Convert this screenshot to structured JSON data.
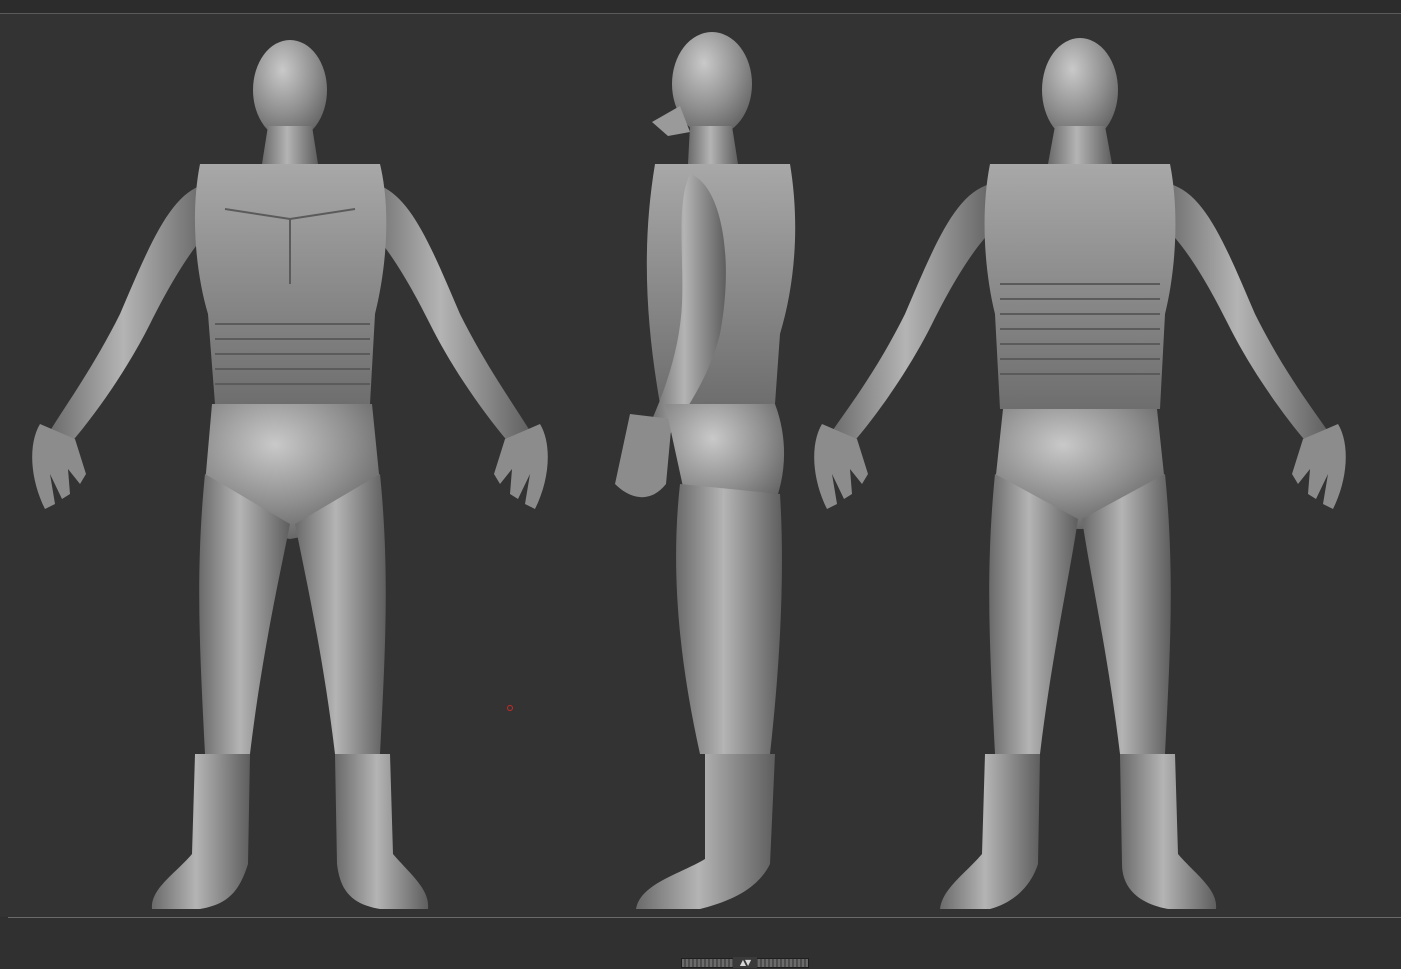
{
  "app": {
    "theme": {
      "background": "#333333",
      "model_color": "#9a9a9a",
      "cursor_color": "#c62a2a"
    }
  },
  "viewport": {
    "views": [
      {
        "id": "front",
        "name": "front-view"
      },
      {
        "id": "side",
        "name": "side-view"
      },
      {
        "id": "back",
        "name": "back-view"
      }
    ]
  },
  "shelf": {
    "toggle_glyphs": "▲▼"
  },
  "icons": {
    "shelf_toggle": "up-down-arrows-icon",
    "cursor": "brush-cursor-icon"
  }
}
